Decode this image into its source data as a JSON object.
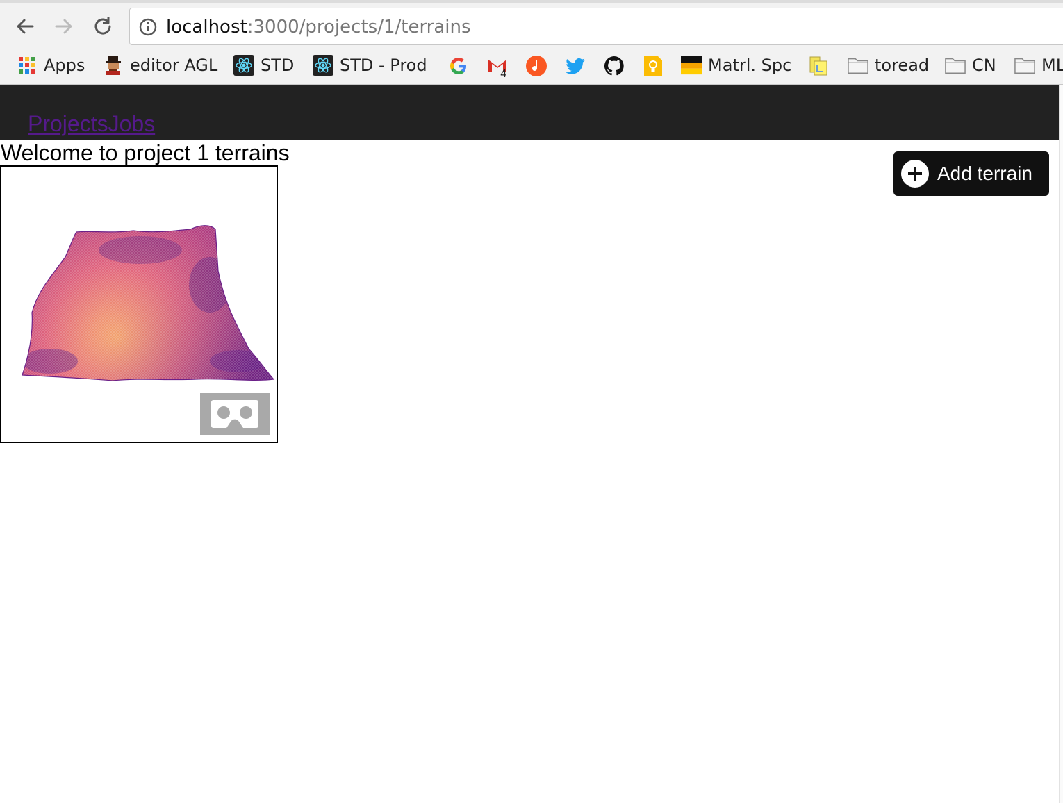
{
  "browser": {
    "url_host": "localhost",
    "url_path": ":3000/projects/1/terrains",
    "bookmarks": [
      {
        "label": "Apps",
        "icon": "apps-grid-icon"
      },
      {
        "label": "editor AGL",
        "icon": "avatar-icon"
      },
      {
        "label": "STD",
        "icon": "react-icon"
      },
      {
        "label": "STD - Prod",
        "icon": "react-icon"
      },
      {
        "label": "",
        "icon": "google-icon"
      },
      {
        "label": "",
        "icon": "gmail-icon",
        "badge": "4"
      },
      {
        "label": "",
        "icon": "music-icon"
      },
      {
        "label": "",
        "icon": "twitter-icon"
      },
      {
        "label": "",
        "icon": "github-icon"
      },
      {
        "label": "",
        "icon": "keep-icon"
      },
      {
        "label": "Matrl. Spc",
        "icon": "flag-icon"
      },
      {
        "label": "",
        "icon": "bookmark-doc-icon"
      },
      {
        "label": "toread",
        "icon": "folder-icon"
      },
      {
        "label": "CN",
        "icon": "folder-icon"
      },
      {
        "label": "ML",
        "icon": "folder-icon"
      }
    ]
  },
  "nav": {
    "projects_link": "Projects",
    "jobs_link": "Jobs"
  },
  "page": {
    "welcome": "Welcome to project 1 terrains",
    "add_terrain_label": "Add terrain"
  },
  "colors": {
    "appbar": "#222222",
    "link_visited": "#551a8b",
    "button_bg": "#111111",
    "vr_button_bg": "#a9a9a9",
    "terrain_low": "#5b1a86",
    "terrain_mid": "#c0447a",
    "terrain_high": "#f6a86a"
  }
}
